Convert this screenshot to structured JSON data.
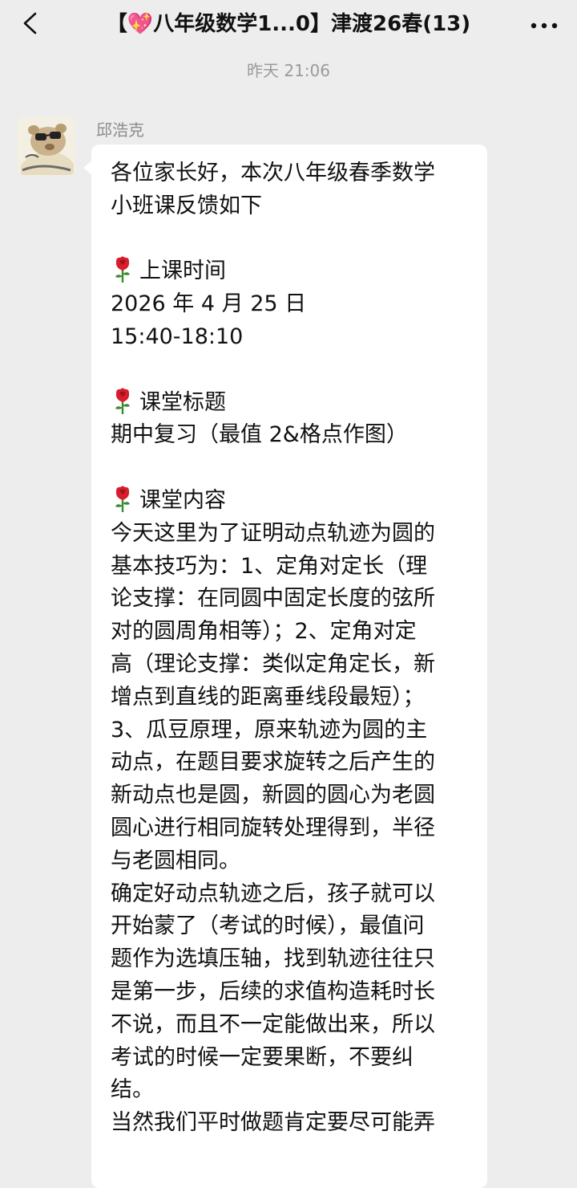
{
  "header": {
    "title": "【💖八年级数学1...0】津渡26春(13)",
    "back_icon": "chevron-left-icon",
    "more_icon": "more-dots-icon"
  },
  "timestamp": "昨天 21:06",
  "message": {
    "sender": "邱浩克",
    "avatar_icon": "cartoon-bear-sunglasses-avatar",
    "emoji_icon": "rose-icon",
    "lines": [
      "各位家长好，本次八年级春季数学",
      "小班课反馈如下",
      "",
      "上课时间",
      "2026 年 4 月 25 日",
      "15:40-18:10",
      "",
      "课堂标题",
      "期中复习（最值 2&格点作图）",
      "",
      "课堂内容",
      "今天这里为了证明动点轨迹为圆的",
      "基本技巧为：1、定角对定长（理",
      "论支撑：在同圆中固定长度的弦所",
      "对的圆周角相等）；2、定角对定",
      "高（理论支撑：类似定角定长，新",
      "增点到直线的距离垂线段最短）；",
      "3、瓜豆原理，原来轨迹为圆的主",
      "动点，在题目要求旋转之后产生的",
      "新动点也是圆，新圆的圆心为老圆",
      "圆心进行相同旋转处理得到，半径",
      "与老圆相同。",
      "确定好动点轨迹之后，孩子就可以",
      "开始蒙了（考试的时候），最值问",
      "题作为选填压轴，找到轨迹往往只",
      "是第一步，后续的求值构造耗时长",
      "不说，而且不一定能做出来，所以",
      "考试的时候一定要果断，不要纠",
      "结。",
      "当然我们平时做题肯定要尽可能弄"
    ]
  },
  "colors": {
    "background": "#ededed",
    "bubble": "#ffffff",
    "timestamp": "#9a9a9a",
    "sender": "#8c8c8c",
    "rose": "#d81e2c"
  }
}
